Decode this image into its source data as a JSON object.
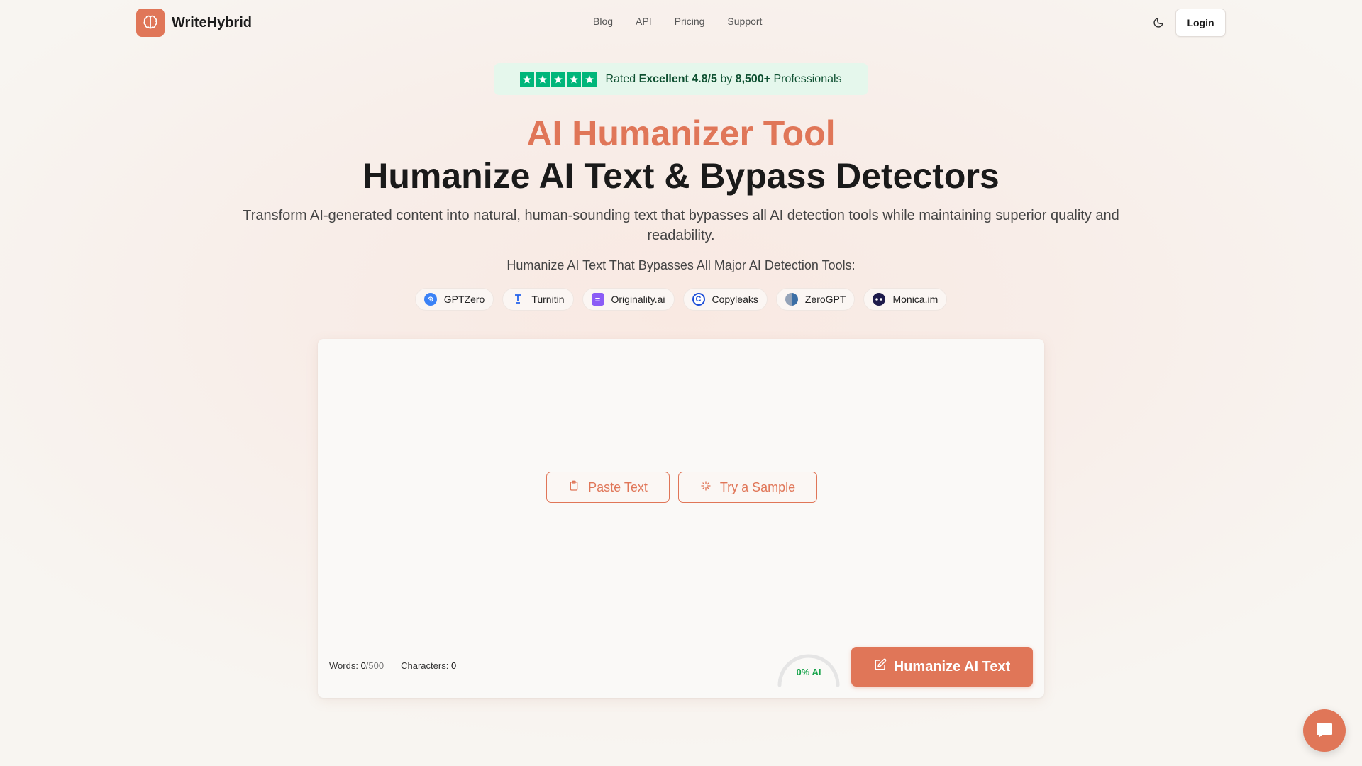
{
  "brand": {
    "name": "WriteHybrid",
    "color": "#e07658"
  },
  "nav": {
    "items": [
      "Blog",
      "API",
      "Pricing",
      "Support"
    ]
  },
  "header": {
    "login_label": "Login",
    "theme_icon": "moon-icon"
  },
  "rating": {
    "stars": 5,
    "prefix": "Rated ",
    "grade": "Excellent 4.8/5",
    "middle": " by ",
    "count": "8,500+",
    "suffix": " Professionals"
  },
  "hero": {
    "title": "AI Humanizer Tool",
    "subtitle": "Humanize AI Text & Bypass Detectors",
    "description": "Transform AI-generated content into natural, human-sounding text that bypasses all AI detection tools while maintaining superior quality and readability.",
    "tools_title": "Humanize AI Text That Bypasses All Major AI Detection Tools:"
  },
  "detectors": [
    {
      "name": "GPTZero",
      "icon": "gptzero-icon",
      "color": "#3b82f6"
    },
    {
      "name": "Turnitin",
      "icon": "turnitin-icon",
      "color": "#2563eb"
    },
    {
      "name": "Originality.ai",
      "icon": "originality-icon",
      "color": "#8b5cf6"
    },
    {
      "name": "Copyleaks",
      "icon": "copyleaks-icon",
      "color": "#1d4ed8"
    },
    {
      "name": "ZeroGPT",
      "icon": "zerogpt-icon",
      "color": "#64748b"
    },
    {
      "name": "Monica.im",
      "icon": "monica-icon",
      "color": "#4f46e5"
    }
  ],
  "editor": {
    "paste_label": "Paste Text",
    "sample_label": "Try a Sample",
    "words_label": "Words:",
    "words_value": "0",
    "words_limit": "/500",
    "chars_label": "Characters:",
    "chars_value": "0",
    "ai_score_label": "0% AI",
    "ai_score": 0,
    "humanize_label": "Humanize AI Text"
  },
  "chat": {
    "icon": "chat-bubble-icon"
  }
}
